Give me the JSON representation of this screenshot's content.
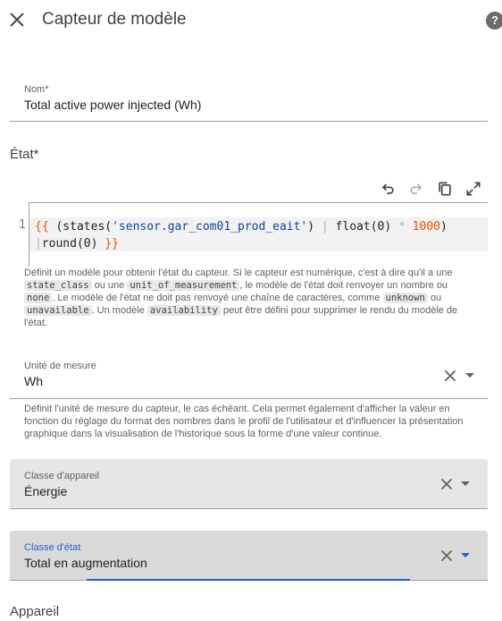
{
  "header": {
    "title": "Capteur de modèle",
    "help_label": "?"
  },
  "name_field": {
    "label": "Nom*",
    "value": "Total active power injected (Wh)"
  },
  "state_section": {
    "title": "État*"
  },
  "editor": {
    "line_number": "1",
    "code": {
      "open": "{{",
      "paren_open": " (states(",
      "string": "'sensor.gar_com01_prod_eait'",
      "paren_close": ") ",
      "pipe1": "|",
      "float_call": " float(0) ",
      "star": "*",
      "num": " 1000",
      "close_paren": ") ",
      "pipe2": "|",
      "round_call": "round(0) ",
      "close": "}}"
    }
  },
  "state_helper": {
    "t1": "Définit un modèle pour obtenir l'état du capteur. Si le capteur est numérique, c'est à dire qu'il a une ",
    "chip1": "state_class",
    "t2": " ou une ",
    "chip2": "unit_of_measurement",
    "t3": ", le modèle de l'état doit renvoyer un nombre ou ",
    "chip3": "none",
    "t4": ". Le modèle de l'état ne doit pas renvoyé une chaîne de caractères, comme ",
    "chip4": "unknown",
    "t5": " ou ",
    "chip5": "unavailable",
    "t6": ". Un modèle ",
    "chip6": "availability",
    "t7": " peut être défini pour supprimer le rendu du modèle de l'état."
  },
  "unit_field": {
    "label": "Unité de mesure",
    "value": "Wh"
  },
  "unit_helper": "Définit l'unité de mesure du capteur, le cas échéant. Cela permet également d'afficher la valeur en fonction du réglage du format des nombres dans le profil de l'utilisateur et d'influencer la présentation graphique dans la visualisation de l'historique sous la forme d'une valeur continue.",
  "device_class": {
    "label": "Classe d'appareil",
    "value": "Énergie"
  },
  "state_class": {
    "label": "Classe d'état",
    "value": "Total en augmentation"
  },
  "device_section": {
    "title": "Appareil"
  },
  "colors": {
    "accent": "#1e63c8",
    "select_bg": "#e6e6e6"
  }
}
